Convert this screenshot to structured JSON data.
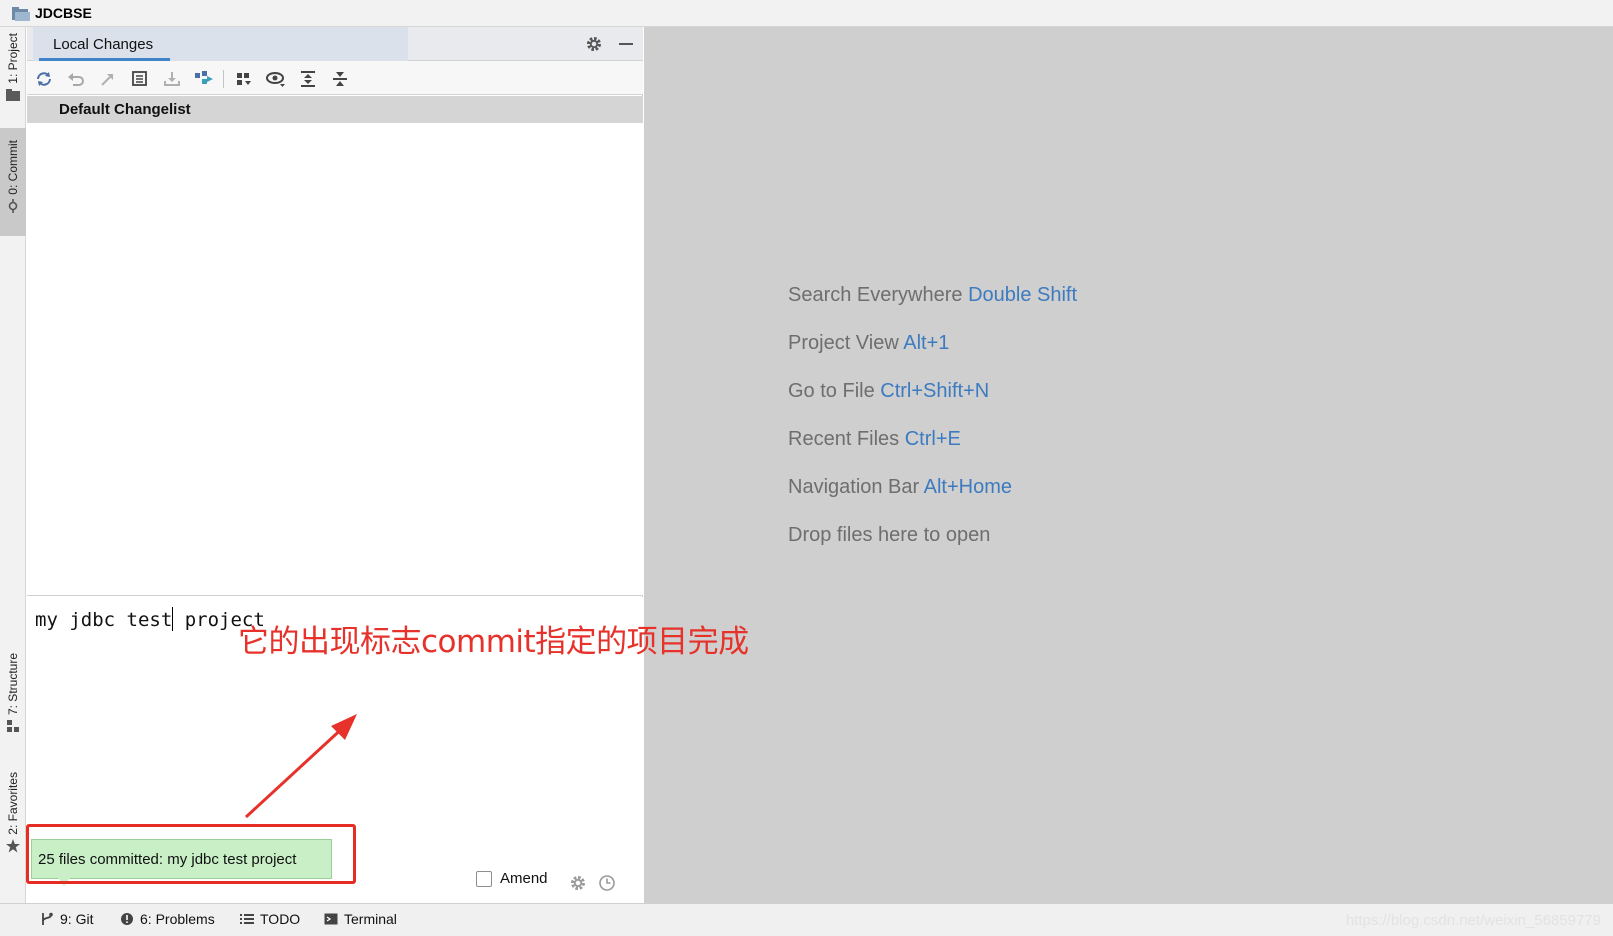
{
  "window": {
    "title": "JDCBSE"
  },
  "left_strip": {
    "project": "1: Project",
    "commit": "0: Commit",
    "structure": "7: Structure",
    "favorites": "2: Favorites"
  },
  "panel": {
    "tab_label": "Local Changes",
    "changelist": "Default Changelist",
    "commit_message": "my jdbc test",
    "commit_message_tail": " project"
  },
  "annotation": {
    "text": "它的出现标志commit指定的项目完成",
    "color": "#e6322a"
  },
  "notification": {
    "text": "25 files committed: my jdbc test project"
  },
  "amend": {
    "label": "Amend",
    "checked": false
  },
  "editor_hints": [
    {
      "text": "Search Everywhere",
      "key": "Double Shift"
    },
    {
      "text": "Project View",
      "key": "Alt+1"
    },
    {
      "text": "Go to File",
      "key": "Ctrl+Shift+N"
    },
    {
      "text": "Recent Files",
      "key": "Ctrl+E"
    },
    {
      "text": "Navigation Bar",
      "key": "Alt+Home"
    },
    {
      "text": "Drop files here to open",
      "key": ""
    }
  ],
  "status_bar": {
    "git": "9: Git",
    "problems": "6: Problems",
    "todo": "TODO",
    "terminal": "Terminal",
    "watermark": "https://blog.csdn.net/weixin_56859779"
  },
  "colors": {
    "accent": "#4083c9",
    "key_blue": "#3d7bc0",
    "notify_bg": "#c9efc7"
  }
}
